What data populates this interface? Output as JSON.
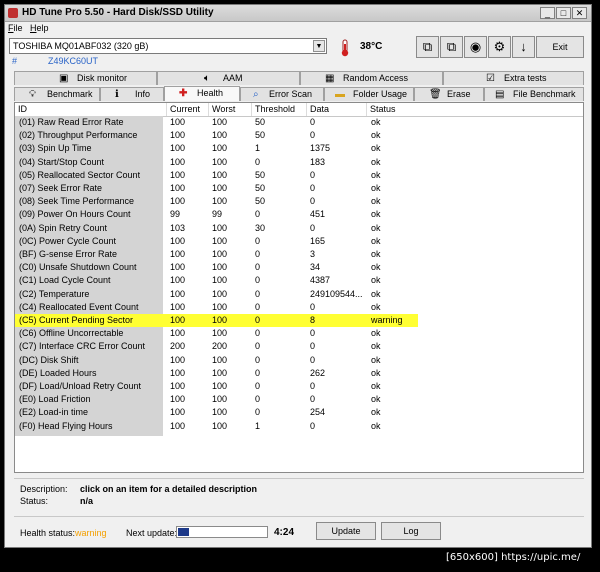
{
  "window": {
    "title": "HD Tune Pro 5.50 - Hard Disk/SSD Utility"
  },
  "menu": {
    "file": "File",
    "help": "Help"
  },
  "drive": {
    "name": "TOSHIBA MQ01ABF032 (320 gB)",
    "serial_prefix": "#",
    "serial": "Z49KC60UT"
  },
  "temperature": "38°C",
  "toolbar": {
    "exit": "Exit"
  },
  "tabs_top": [
    "Disk monitor",
    "AAM",
    "Random Access",
    "Extra tests"
  ],
  "tabs_bottom": [
    "Benchmark",
    "Info",
    "Health",
    "Error Scan",
    "Folder Usage",
    "Erase",
    "File Benchmark"
  ],
  "active_tab": "Health",
  "columns": [
    "ID",
    "Current",
    "Worst",
    "Threshold",
    "Data",
    "Status"
  ],
  "rows": [
    {
      "id": "(01) Raw Read Error Rate",
      "current": "100",
      "worst": "100",
      "threshold": "50",
      "data": "0",
      "status": "ok"
    },
    {
      "id": "(02) Throughput Performance",
      "current": "100",
      "worst": "100",
      "threshold": "50",
      "data": "0",
      "status": "ok"
    },
    {
      "id": "(03) Spin Up Time",
      "current": "100",
      "worst": "100",
      "threshold": "1",
      "data": "1375",
      "status": "ok"
    },
    {
      "id": "(04) Start/Stop Count",
      "current": "100",
      "worst": "100",
      "threshold": "0",
      "data": "183",
      "status": "ok"
    },
    {
      "id": "(05) Reallocated Sector Count",
      "current": "100",
      "worst": "100",
      "threshold": "50",
      "data": "0",
      "status": "ok"
    },
    {
      "id": "(07) Seek Error Rate",
      "current": "100",
      "worst": "100",
      "threshold": "50",
      "data": "0",
      "status": "ok"
    },
    {
      "id": "(08) Seek Time Performance",
      "current": "100",
      "worst": "100",
      "threshold": "50",
      "data": "0",
      "status": "ok"
    },
    {
      "id": "(09) Power On Hours Count",
      "current": "99",
      "worst": "99",
      "threshold": "0",
      "data": "451",
      "status": "ok"
    },
    {
      "id": "(0A) Spin Retry Count",
      "current": "103",
      "worst": "100",
      "threshold": "30",
      "data": "0",
      "status": "ok"
    },
    {
      "id": "(0C) Power Cycle Count",
      "current": "100",
      "worst": "100",
      "threshold": "0",
      "data": "165",
      "status": "ok"
    },
    {
      "id": "(BF) G-sense Error Rate",
      "current": "100",
      "worst": "100",
      "threshold": "0",
      "data": "3",
      "status": "ok"
    },
    {
      "id": "(C0) Unsafe Shutdown Count",
      "current": "100",
      "worst": "100",
      "threshold": "0",
      "data": "34",
      "status": "ok"
    },
    {
      "id": "(C1) Load Cycle Count",
      "current": "100",
      "worst": "100",
      "threshold": "0",
      "data": "4387",
      "status": "ok"
    },
    {
      "id": "(C2) Temperature",
      "current": "100",
      "worst": "100",
      "threshold": "0",
      "data": "249109544...",
      "status": "ok"
    },
    {
      "id": "(C4) Reallocated Event Count",
      "current": "100",
      "worst": "100",
      "threshold": "0",
      "data": "0",
      "status": "ok"
    },
    {
      "id": "(C5) Current Pending Sector",
      "current": "100",
      "worst": "100",
      "threshold": "0",
      "data": "8",
      "status": "warning"
    },
    {
      "id": "(C6) Offline Uncorrectable",
      "current": "100",
      "worst": "100",
      "threshold": "0",
      "data": "0",
      "status": "ok"
    },
    {
      "id": "(C7) Interface CRC Error Count",
      "current": "200",
      "worst": "200",
      "threshold": "0",
      "data": "0",
      "status": "ok"
    },
    {
      "id": "(DC) Disk Shift",
      "current": "100",
      "worst": "100",
      "threshold": "0",
      "data": "0",
      "status": "ok"
    },
    {
      "id": "(DE) Loaded Hours",
      "current": "100",
      "worst": "100",
      "threshold": "0",
      "data": "262",
      "status": "ok"
    },
    {
      "id": "(DF) Load/Unload Retry Count",
      "current": "100",
      "worst": "100",
      "threshold": "0",
      "data": "0",
      "status": "ok"
    },
    {
      "id": "(E0) Load Friction",
      "current": "100",
      "worst": "100",
      "threshold": "0",
      "data": "0",
      "status": "ok"
    },
    {
      "id": "(E2) Load-in time",
      "current": "100",
      "worst": "100",
      "threshold": "0",
      "data": "254",
      "status": "ok"
    },
    {
      "id": "(F0) Head Flying Hours",
      "current": "100",
      "worst": "100",
      "threshold": "1",
      "data": "0",
      "status": "ok"
    }
  ],
  "detail": {
    "description_label": "Description:",
    "description": "click on an item for a detailed description",
    "status_label": "Status:",
    "status": "n/a"
  },
  "bottom": {
    "health_status_label": "Health status:",
    "health_status": "warning",
    "next_update_label": "Next update:",
    "progress_fraction": 0.12,
    "time": "4:24",
    "update": "Update",
    "log": "Log"
  },
  "footer": "[650x600] https://upic.me/",
  "colors": {
    "warning_row": "#ffff33",
    "warning_text": "#f4a000",
    "serial_text": "#2a64c8",
    "id_column": "#d4d4d4"
  }
}
